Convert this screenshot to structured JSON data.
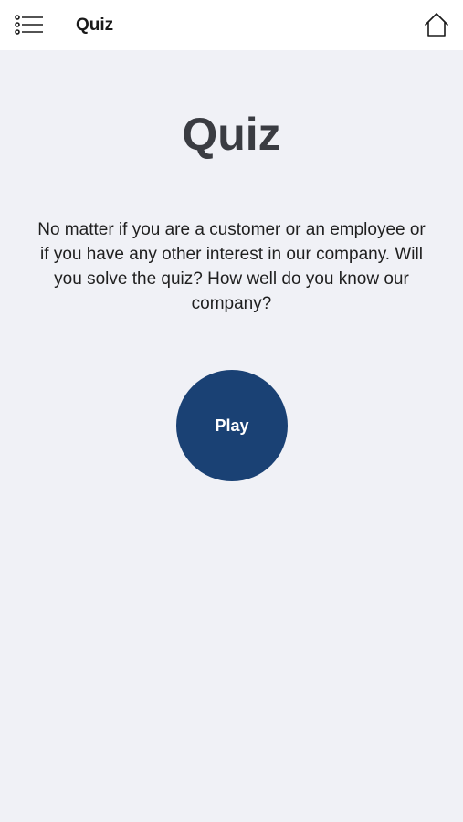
{
  "header": {
    "title": "Quiz",
    "menu_icon": "list-menu-icon",
    "home_icon": "home-icon"
  },
  "main": {
    "title": "Quiz",
    "intro": "No matter if you are a customer or an employee or if you have any other interest in our company. Will you solve the quiz? How well do you know our company?",
    "play_label": "Play"
  },
  "colors": {
    "background": "#f0f1f6",
    "header_background": "#ffffff",
    "accent": "#1a4174",
    "title_text": "#3a3c42"
  }
}
